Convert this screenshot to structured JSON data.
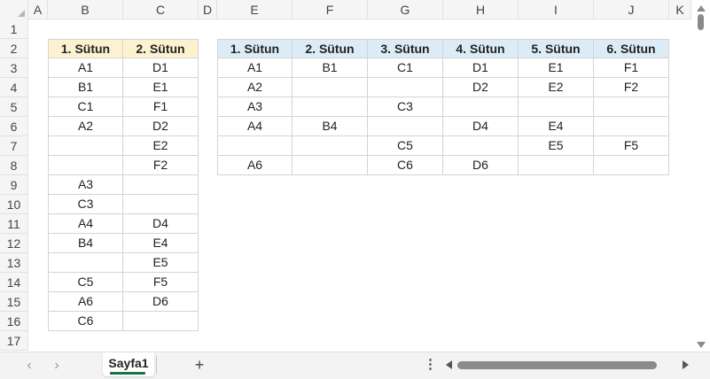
{
  "columns": [
    "A",
    "B",
    "C",
    "D",
    "E",
    "F",
    "G",
    "H",
    "I",
    "J",
    "K"
  ],
  "rows": [
    "1",
    "2",
    "3",
    "4",
    "5",
    "6",
    "7",
    "8",
    "9",
    "10",
    "11",
    "12",
    "13",
    "14",
    "15",
    "16",
    "17"
  ],
  "table_left": {
    "headers": [
      "1. Sütun",
      "2. Sütun"
    ],
    "rows": [
      [
        "A1",
        "D1"
      ],
      [
        "B1",
        "E1"
      ],
      [
        "C1",
        "F1"
      ],
      [
        "A2",
        "D2"
      ],
      [
        "",
        "E2"
      ],
      [
        "",
        "F2"
      ],
      [
        "A3",
        ""
      ],
      [
        "C3",
        ""
      ],
      [
        "A4",
        "D4"
      ],
      [
        "B4",
        "E4"
      ],
      [
        "",
        "E5"
      ],
      [
        "C5",
        "F5"
      ],
      [
        "A6",
        "D6"
      ],
      [
        "C6",
        ""
      ]
    ]
  },
  "table_right": {
    "headers": [
      "1. Sütun",
      "2. Sütun",
      "3. Sütun",
      "4. Sütun",
      "5. Sütun",
      "6. Sütun"
    ],
    "rows": [
      [
        "A1",
        "B1",
        "C1",
        "D1",
        "E1",
        "F1"
      ],
      [
        "A2",
        "",
        "",
        "D2",
        "E2",
        "F2"
      ],
      [
        "A3",
        "",
        "C3",
        "",
        "",
        ""
      ],
      [
        "A4",
        "B4",
        "",
        "D4",
        "E4",
        ""
      ],
      [
        "",
        "",
        "C5",
        "",
        "E5",
        "F5"
      ],
      [
        "A6",
        "",
        "C6",
        "D6",
        "",
        ""
      ]
    ]
  },
  "sheet_tab": {
    "label": "Sayfa1"
  },
  "controls": {
    "add_sheet": "+",
    "more_options": "⋮",
    "nav_prev": "‹",
    "nav_next": "›"
  },
  "colors": {
    "header_yellow": "#fdf2d0",
    "header_blue": "#dcecf7",
    "sheet_tab_accent": "#1e7145"
  }
}
